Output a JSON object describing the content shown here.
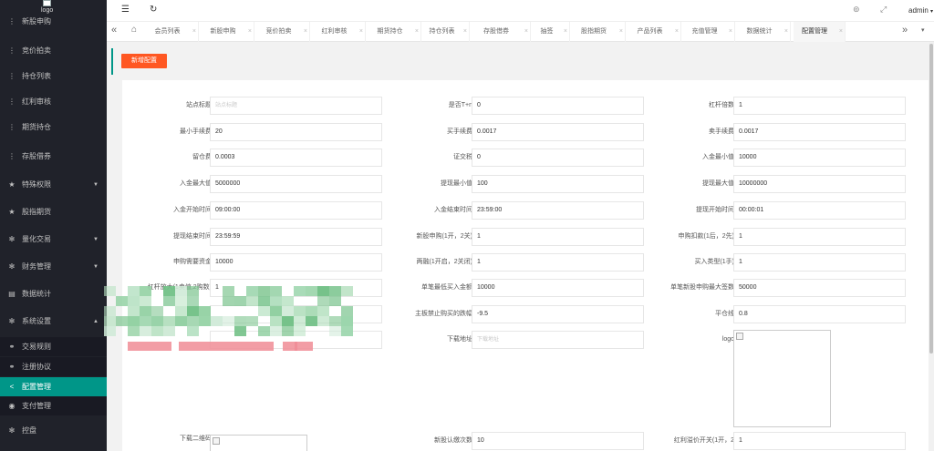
{
  "sidebar": {
    "logo_text": "logo",
    "items": [
      {
        "label": "新股申购",
        "icon": "menu-dots-icon"
      },
      {
        "label": "竞价拍卖",
        "icon": "menu-dots-icon"
      },
      {
        "label": "持仓列表",
        "icon": "menu-dots-icon"
      },
      {
        "label": "红利审核",
        "icon": "menu-dots-icon"
      },
      {
        "label": "期货持仓",
        "icon": "menu-dots-icon"
      },
      {
        "label": "存股借券",
        "icon": "menu-dots-icon"
      },
      {
        "label": "特殊权限",
        "icon": "star-icon",
        "expandable": true
      },
      {
        "label": "股指期货",
        "icon": "star-icon"
      },
      {
        "label": "量化交易",
        "icon": "gear-icon",
        "expandable": true
      },
      {
        "label": "财务管理",
        "icon": "gear-icon",
        "expandable": true
      },
      {
        "label": "数据统计",
        "icon": "doc-icon"
      },
      {
        "label": "系统设置",
        "icon": "gear-icon",
        "expandable": true,
        "expanded": true
      }
    ],
    "sub_items": [
      {
        "label": "交易规则",
        "icon": "link-icon"
      },
      {
        "label": "注册协议",
        "icon": "link-icon"
      },
      {
        "label": "配置管理",
        "icon": "share-icon",
        "active": true
      },
      {
        "label": "支付管理",
        "icon": "coin-icon"
      }
    ],
    "bottom_item": {
      "label": "控盘",
      "icon": "gear-icon"
    }
  },
  "topbar": {
    "menu_toggle_icon": "hamburger-icon",
    "refresh_icon": "refresh-icon",
    "theme_icon": "palette-icon",
    "fullscreen_icon": "fullscreen-icon",
    "user_label": "admin"
  },
  "tabs": [
    {
      "label": "会员列表"
    },
    {
      "label": "新股申购"
    },
    {
      "label": "竞价拍卖"
    },
    {
      "label": "红利审核"
    },
    {
      "label": "期货持仓"
    },
    {
      "label": "持仓列表"
    },
    {
      "label": "存股借券"
    },
    {
      "label": "抽签"
    },
    {
      "label": "股指期货"
    },
    {
      "label": "产品列表"
    },
    {
      "label": "充值管理"
    },
    {
      "label": "数据统计"
    },
    {
      "label": "配置管理",
      "current": true
    }
  ],
  "main": {
    "add_button": "新增配置",
    "fields": [
      {
        "label": "站点标题",
        "value": "",
        "placeholder": "站点标题"
      },
      {
        "label": "是否T+n",
        "value": "0"
      },
      {
        "label": "杠杆倍数",
        "value": "1"
      },
      {
        "label": "最小手续费",
        "value": "20"
      },
      {
        "label": "买手续费",
        "value": "0.0017"
      },
      {
        "label": "卖手续费",
        "value": "0.0017"
      },
      {
        "label": "留仓费",
        "value": "0.0003"
      },
      {
        "label": "证交税",
        "value": "0"
      },
      {
        "label": "入金最小值",
        "value": "10000"
      },
      {
        "label": "入金最大值",
        "value": "5000000"
      },
      {
        "label": "提现最小值",
        "value": "100"
      },
      {
        "label": "提现最大值",
        "value": "10000000"
      },
      {
        "label": "入金开始时间",
        "value": "09:00:00"
      },
      {
        "label": "入金结束时间",
        "value": "23:59:00"
      },
      {
        "label": "提现开始时间",
        "value": "00:00:01"
      },
      {
        "label": "提现结束时间",
        "value": "23:59:59"
      },
      {
        "label": "新股申购(1开，2关)",
        "value": "1"
      },
      {
        "label": "申购扣款(1后，2先)",
        "value": "1"
      },
      {
        "label": "申购需要资金",
        "value": "10000"
      },
      {
        "label": "两融(1开启，2关闭)",
        "value": "1"
      },
      {
        "label": "买入类型(1手)",
        "value": "1"
      },
      {
        "label": "杠杆放大(1卖值,2购数)",
        "value": "1"
      },
      {
        "label": "单笔最低买入金额",
        "value": "10000"
      },
      {
        "label": "单笔新股申购最大签数",
        "value": "50000"
      },
      {
        "label": "",
        "value": ""
      },
      {
        "label": "主板禁止购买的跌幅",
        "value": "-9.5"
      },
      {
        "label": "平仓线",
        "value": "0.8"
      },
      {
        "label": "",
        "value": ""
      },
      {
        "label": "下载地址",
        "value": "",
        "placeholder": "下载地址"
      },
      {
        "label": "logo",
        "value": ""
      },
      {
        "label": "下载二维码",
        "value": ""
      },
      {
        "label": "新股认缴次数",
        "value": "10"
      },
      {
        "label": "红利溢价开关(1开，2",
        "value": "1"
      }
    ]
  },
  "colors": {
    "sidebar_bg": "#20222a",
    "active_menu": "#009688",
    "primary_button": "#ff5722",
    "redaction_green": "#7cc48e",
    "redaction_pink": "#f08c95"
  }
}
